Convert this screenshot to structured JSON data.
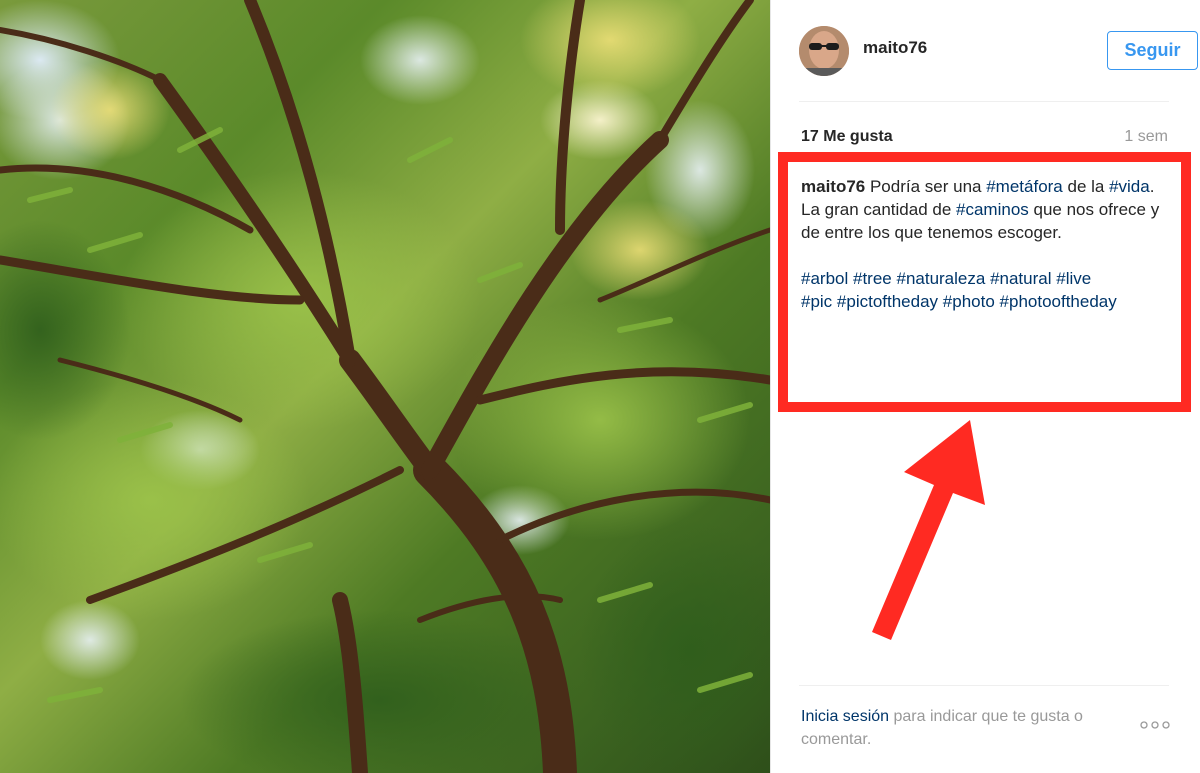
{
  "post": {
    "username": "maito76",
    "follow_label": "Seguir",
    "likes": "17 Me gusta",
    "time": "1 sem"
  },
  "caption": {
    "username": "maito76",
    "t1": " Podría ser una ",
    "tag_metafora": "#metáfora",
    "t2": " de la ",
    "tag_vida": "#vida",
    "t3": ". La gran cantidad de ",
    "tag_caminos": "#caminos",
    "t4": " que nos ofrece y de entre los que tenemos escoger.",
    "hashtags": [
      "#arbol",
      "#tree",
      "#naturaleza",
      "#natural",
      "#live",
      "#pic",
      "#pictoftheday",
      "#photo",
      "#photooftheday"
    ]
  },
  "footer": {
    "login_link": "Inicia sesión",
    "rest": " para indicar que te gusta o comentar."
  },
  "colors": {
    "link": "#003569",
    "follow": "#3897f0",
    "highlight": "#ff2a22"
  },
  "icons": {
    "more": "more-options-icon",
    "arrow": "red-annotation-arrow"
  }
}
